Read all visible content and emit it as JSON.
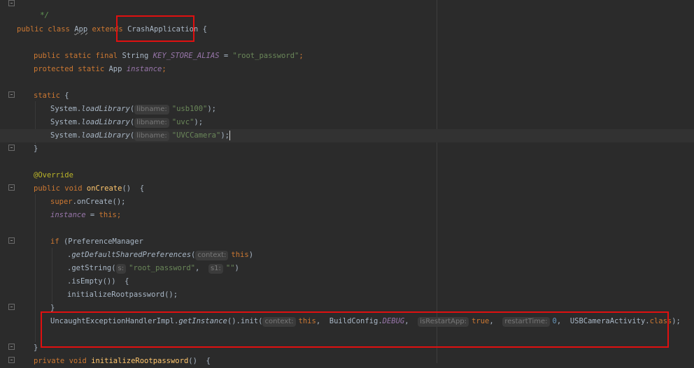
{
  "editor": {
    "comment_end": "*/",
    "class_decl": {
      "public": "public",
      "class": "class",
      "name": "App",
      "extends": "extends",
      "super": "CrashApplication",
      "brace": "{"
    },
    "field1": {
      "mods": "public static final",
      "type": "String",
      "name": "KEY_STORE_ALIAS",
      "eq": "=",
      "value": "\"root_password\"",
      "semi": ";"
    },
    "field2": {
      "mods": "protected static",
      "type": "App",
      "name": "instance",
      "semi": ";"
    },
    "static_block": {
      "kw": "static",
      "brace": "{"
    },
    "load_libs": [
      {
        "obj": "System.",
        "method": "loadLibrary",
        "open": "(",
        "hint": "libname:",
        "arg": "\"usb100\"",
        "close": ");"
      },
      {
        "obj": "System.",
        "method": "loadLibrary",
        "open": "(",
        "hint": "libname:",
        "arg": "\"uvc\"",
        "close": ");"
      },
      {
        "obj": "System.",
        "method": "loadLibrary",
        "open": "(",
        "hint": "libname:",
        "arg": "\"UVCCamera\"",
        "close": ");"
      }
    ],
    "close_brace": "}",
    "override": "@Override",
    "oncreate": {
      "mods": "public void",
      "name": "onCreate",
      "rest": "()  {"
    },
    "super_call": {
      "kw": "super",
      "rest": ".onCreate();"
    },
    "assign": {
      "field": "instance",
      "eq": " = ",
      "kw": "this",
      "semi": ";"
    },
    "if_line": {
      "kw": "if",
      "rest": " (PreferenceManager"
    },
    "chain1": {
      "dot": ".",
      "method": "getDefaultSharedPreferences",
      "open": "(",
      "hint": "context:",
      "kw": "this",
      "close": ")"
    },
    "chain2": {
      "text": ".getString(",
      "hint_s": "s:",
      "arg": "\"root_password\"",
      "comma": ",  ",
      "hint_s1": "s1:",
      "arg2": "\"\"",
      "close": ")"
    },
    "chain3": {
      "text": ".isEmpty())  {"
    },
    "init_call": "initializeRootpassword();",
    "handler": {
      "cls": "UncaughtExceptionHandlerImpl.",
      "method": "getInstance",
      "rest": "().init(",
      "hint_ctx": "context:",
      "this": "this",
      "comma": ",  ",
      "build": "BuildConfig.",
      "debug": "DEBUG",
      "hint_restart": "isRestartApp:",
      "true": "true",
      "hint_time": "restartTime:",
      "zero": "0",
      "cls2": "USBCameraActivity.",
      "class_kw": "class",
      "end": ");"
    },
    "private_line": {
      "mods": "private void",
      "name": "initializeRootpassword",
      "rest": "()  {"
    }
  },
  "colors": {
    "background": "#2b2b2b",
    "keyword": "#cc7832",
    "string": "#6a8759",
    "field": "#9876aa",
    "highlight_box": "#e01010"
  }
}
